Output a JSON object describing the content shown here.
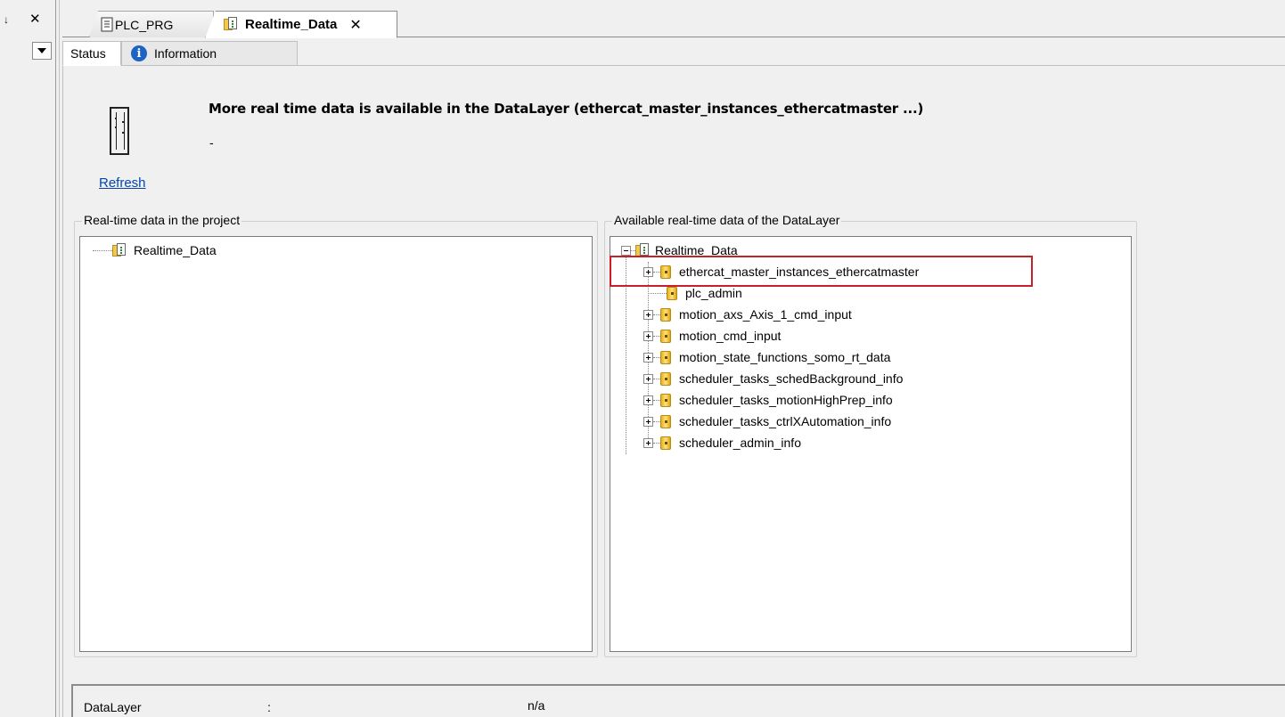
{
  "left_strip": {
    "pin_glyph": "♒",
    "close_glyph": "✕"
  },
  "doc_tabs": [
    {
      "label": "PLC_PRG",
      "active": false
    },
    {
      "label": "Realtime_Data",
      "active": true,
      "close_glyph": "✕"
    }
  ],
  "sub_tabs": [
    {
      "label": "Status",
      "active": true
    },
    {
      "label": "Information",
      "active": false,
      "icon_glyph": "i"
    }
  ],
  "status": {
    "message": "More real time data is available in the DataLayer (ethercat_master_instances_ethercatmaster ...)",
    "secondary": "-",
    "refresh_label": "Refresh"
  },
  "project_group": {
    "title": "Real-time data in the project",
    "tree_root": "Realtime_Data"
  },
  "datalayer_group": {
    "title": "Available real-time data of the DataLayer",
    "tree_root": "Realtime_Data",
    "items": [
      {
        "label": "ethercat_master_instances_ethercatmaster",
        "expandable": true,
        "highlighted": true
      },
      {
        "label": "plc_admin",
        "expandable": false
      },
      {
        "label": "motion_axs_Axis_1_cmd_input",
        "expandable": true
      },
      {
        "label": "motion_cmd_input",
        "expandable": true
      },
      {
        "label": "motion_state_functions_somo_rt_data",
        "expandable": true
      },
      {
        "label": "scheduler_tasks_schedBackground_info",
        "expandable": true
      },
      {
        "label": "scheduler_tasks_motionHighPrep_info",
        "expandable": true
      },
      {
        "label": "scheduler_tasks_ctrlXAutomation_info",
        "expandable": true
      },
      {
        "label": "scheduler_admin_info",
        "expandable": true
      }
    ]
  },
  "bottom": {
    "key": "DataLayer",
    "sep": ":",
    "value": "n/a"
  },
  "colors": {
    "highlight": "#c8202a",
    "link": "#0645ad"
  }
}
